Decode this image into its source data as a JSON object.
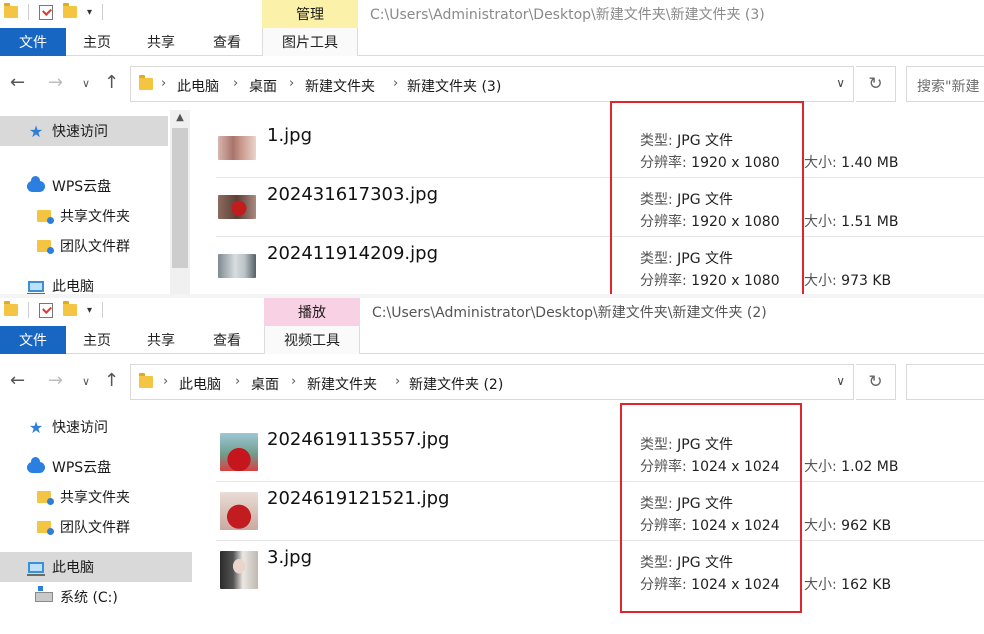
{
  "windows": [
    {
      "qat_dropdown": "▾",
      "context_tab": "管理",
      "title_path": "C:\\Users\\Administrator\\Desktop\\新建文件夹\\新建文件夹 (3)",
      "ribbon_tabs": {
        "file": "文件",
        "home": "主页",
        "share": "共享",
        "view": "查看",
        "tool": "图片工具"
      },
      "address": {
        "crumbs": [
          "此电脑",
          "桌面",
          "新建文件夹",
          "新建文件夹 (3)"
        ]
      },
      "search_placeholder": "搜索\"新建",
      "sidebar": [
        {
          "label": "快速访问",
          "icon": "star-icon"
        },
        {
          "label": "WPS云盘",
          "icon": "cloud-icon"
        },
        {
          "label": "共享文件夹",
          "icon": "shared-folder-icon"
        },
        {
          "label": "团队文件群",
          "icon": "shared-folder-icon"
        },
        {
          "label": "此电脑",
          "icon": "computer-icon"
        }
      ],
      "files": [
        {
          "name": "1.jpg",
          "type_label": "类型:",
          "type_value": "JPG 文件",
          "res_label": "分辨率:",
          "res_value": "1920 x 1080",
          "size_label": "大小:",
          "size_value": "1.40 MB"
        },
        {
          "name": "202431617303.jpg",
          "type_label": "类型:",
          "type_value": "JPG 文件",
          "res_label": "分辨率:",
          "res_value": "1920 x 1080",
          "size_label": "大小:",
          "size_value": "1.51 MB"
        },
        {
          "name": "202411914209.jpg",
          "type_label": "类型:",
          "type_value": "JPG 文件",
          "res_label": "分辨率:",
          "res_value": "1920 x 1080",
          "size_label": "大小:",
          "size_value": "973 KB"
        }
      ]
    },
    {
      "qat_dropdown": "▾",
      "context_tab": "播放",
      "title_path": "C:\\Users\\Administrator\\Desktop\\新建文件夹\\新建文件夹 (2)",
      "ribbon_tabs": {
        "file": "文件",
        "home": "主页",
        "share": "共享",
        "view": "查看",
        "tool": "视频工具"
      },
      "address": {
        "crumbs": [
          "此电脑",
          "桌面",
          "新建文件夹",
          "新建文件夹 (2)"
        ]
      },
      "sidebar": [
        {
          "label": "快速访问",
          "icon": "star-icon"
        },
        {
          "label": "WPS云盘",
          "icon": "cloud-icon"
        },
        {
          "label": "共享文件夹",
          "icon": "shared-folder-icon"
        },
        {
          "label": "团队文件群",
          "icon": "shared-folder-icon"
        },
        {
          "label": "此电脑",
          "icon": "computer-icon"
        },
        {
          "label": "系统 (C:)",
          "icon": "drive-icon"
        }
      ],
      "files": [
        {
          "name": "2024619113557.jpg",
          "type_label": "类型:",
          "type_value": "JPG 文件",
          "res_label": "分辨率:",
          "res_value": "1024 x 1024",
          "size_label": "大小:",
          "size_value": "1.02 MB"
        },
        {
          "name": "2024619121521.jpg",
          "type_label": "类型:",
          "type_value": "JPG 文件",
          "res_label": "分辨率:",
          "res_value": "1024 x 1024",
          "size_label": "大小:",
          "size_value": "962 KB"
        },
        {
          "name": "3.jpg",
          "type_label": "类型:",
          "type_value": "JPG 文件",
          "res_label": "分辨率:",
          "res_value": "1024 x 1024",
          "size_label": "大小:",
          "size_value": "162 KB"
        }
      ]
    }
  ],
  "colors": {
    "file_tab": "#1766c2",
    "manage_tab": "#fbf1a8",
    "play_tab": "#f9d1e4",
    "highlight_box": "#e0262a"
  }
}
